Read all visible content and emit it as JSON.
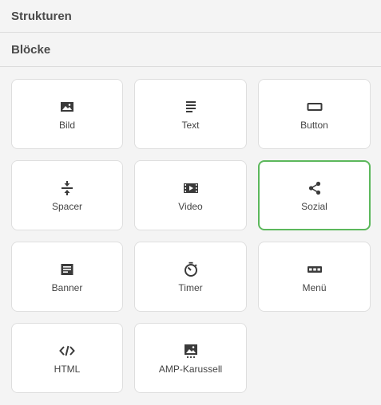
{
  "sections": {
    "structures_label": "Strukturen",
    "blocks_label": "Blöcke"
  },
  "blocks": [
    {
      "label": "Bild",
      "icon": "image-icon"
    },
    {
      "label": "Text",
      "icon": "text-icon"
    },
    {
      "label": "Button",
      "icon": "button-icon"
    },
    {
      "label": "Spacer",
      "icon": "spacer-icon"
    },
    {
      "label": "Video",
      "icon": "video-icon"
    },
    {
      "label": "Sozial",
      "icon": "share-icon"
    },
    {
      "label": "Banner",
      "icon": "banner-icon"
    },
    {
      "label": "Timer",
      "icon": "timer-icon"
    },
    {
      "label": "Menü",
      "icon": "menu-icon"
    },
    {
      "label": "HTML",
      "icon": "code-icon"
    },
    {
      "label": "AMP-Karussell",
      "icon": "carousel-icon"
    }
  ],
  "selected_block": "Sozial",
  "colors": {
    "selected_border": "#5cb85c",
    "icon": "#3a3a3a"
  }
}
